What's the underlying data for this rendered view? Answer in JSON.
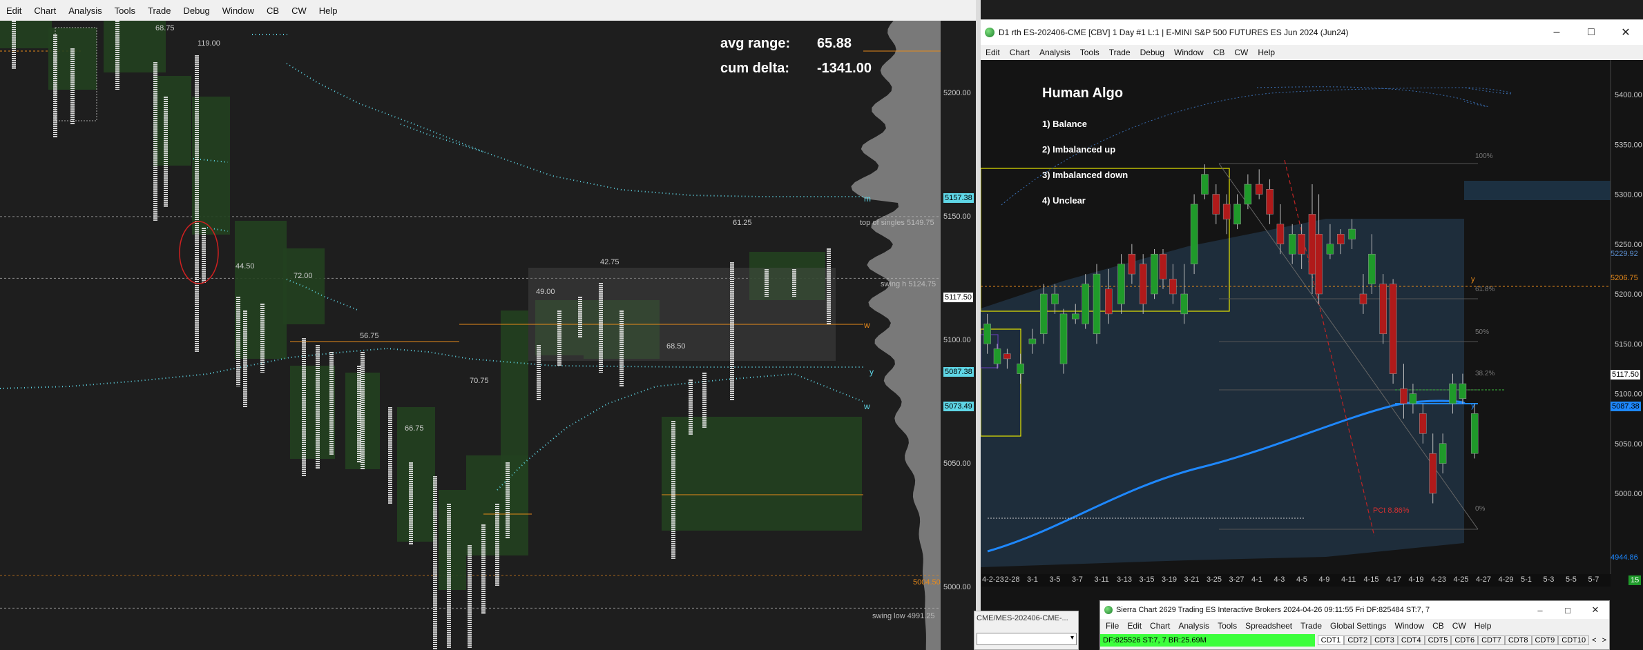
{
  "left_window": {
    "menu": [
      "Edit",
      "Chart",
      "Analysis",
      "Tools",
      "Trade",
      "Debug",
      "Window",
      "CB",
      "CW",
      "Help"
    ],
    "stats": {
      "avg_range_label": "avg range:",
      "avg_range_value": "65.88",
      "cum_delta_label": "cum delta:",
      "cum_delta_value": "-1341.00"
    },
    "price_axis": [
      "5200.00",
      "5150.00",
      "5100.00",
      "5050.00",
      "5000.00"
    ],
    "price_tags": {
      "p5157": "5157.38",
      "p5117": "5117.50",
      "p5087": "5087.38",
      "p5073": "5073.49",
      "p5004": "5004.50"
    },
    "annotations": {
      "top_singles": "top of singles  5149.75",
      "swing_h": "swing h  5124.75",
      "swing_low": "swing low  4991.25",
      "r68": "68.75",
      "r119": "119.00",
      "r44": "44.50",
      "r72": "72.00",
      "r56": "56.75",
      "r70": "70.75",
      "r66": "66.75",
      "r49": "49.00",
      "r42": "42.75",
      "r68b": "68.50",
      "r61": "61.25",
      "m": "m",
      "w1": "w",
      "y": "y",
      "w2": "w"
    }
  },
  "right_window": {
    "title": "D1 rth ES-202406-CME [CBV]  1 Day  #1 L:1 | E-MINI S&P 500 FUTURES ES Jun 2024 (Jun24)",
    "menu": [
      "Edit",
      "Chart",
      "Analysis",
      "Tools",
      "Trade",
      "Debug",
      "Window",
      "CB",
      "CW",
      "Help"
    ],
    "legend": {
      "title": "Human Algo",
      "items": [
        "1)  Balance",
        "2)  Imbalanced up",
        "3)  Imbalanced down",
        "4)  Unclear"
      ]
    },
    "price_axis": [
      "5400.00",
      "5350.00",
      "5300.00",
      "5250.00",
      "5200.00",
      "5150.00",
      "5100.00",
      "5050.00",
      "5000.00"
    ],
    "price_tags": {
      "p5229": "5229.92",
      "p5206": "5206.75",
      "p5117": "5117.50",
      "p5087": "5087.38",
      "p4944": "4944.86"
    },
    "fib": [
      "100%",
      "61.8%",
      "50%",
      "38.2%",
      "0%"
    ],
    "pct_label": "PCt 8.86%",
    "line_labels": {
      "y1": "y",
      "y2": "y"
    },
    "dates": [
      "4-2-23",
      "2-28",
      "3-1",
      "3-5",
      "3-7",
      "3-11",
      "3-13",
      "3-15",
      "3-19",
      "3-21",
      "3-25",
      "3-27",
      "4-1",
      "4-3",
      "4-5",
      "4-9",
      "4-11",
      "4-15",
      "4-17",
      "4-19",
      "4-23",
      "4-25",
      "4-27",
      "4-29",
      "5-1",
      "5-3",
      "5-5",
      "5-7"
    ],
    "corner_value": "15"
  },
  "sierra_window": {
    "title": "Sierra Chart 2629 Trading ES Interactive Brokers 2024-04-26  09:11:55 Fri DF:825484  ST:7, 7",
    "menu": [
      "File",
      "Edit",
      "Chart",
      "Analysis",
      "Tools",
      "Spreadsheet",
      "Trade",
      "Global Settings",
      "Window",
      "CB",
      "CW",
      "Help"
    ],
    "status": "DF:825526  ST:7, 7  BR:25.69M",
    "tabs": [
      "CDT1",
      "CDT2",
      "CDT3",
      "CDT4",
      "CDT5",
      "CDT6",
      "CDT7",
      "CDT8",
      "CDT9",
      "CDT10"
    ]
  },
  "small_window": {
    "title": "CME/MES-202406-CME-..."
  },
  "colors": {
    "bg_dark": "#1e1e1e",
    "bg_right": "#141414",
    "green_box": "#22401f",
    "cyan": "#5fd6e6",
    "orange": "#e88a1a",
    "bull": "#1f9a2a",
    "bear": "#b01a1a",
    "blue_line": "#1e88ff",
    "yellow": "#e6e600"
  }
}
